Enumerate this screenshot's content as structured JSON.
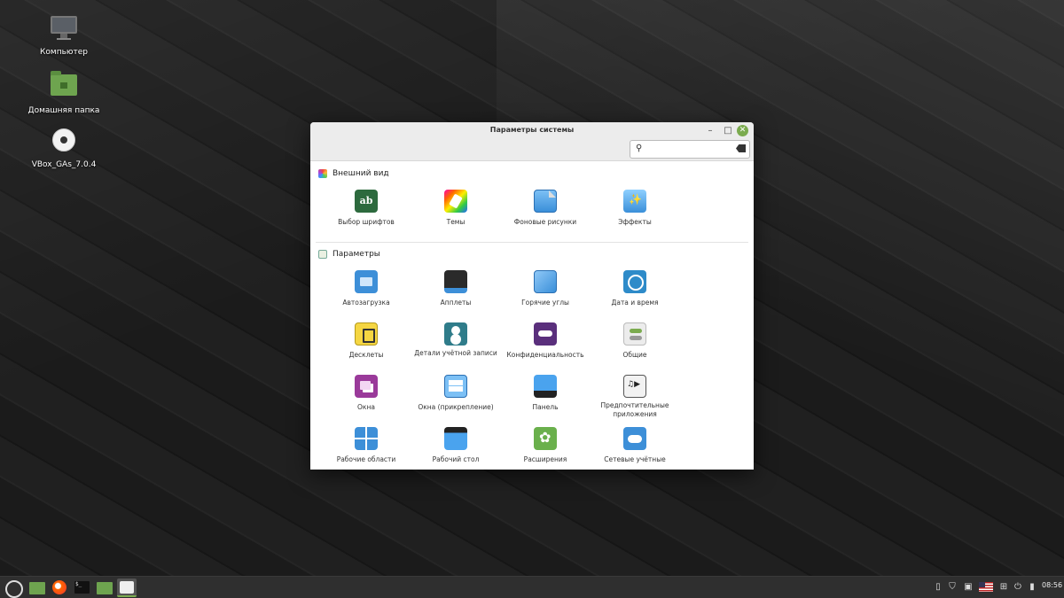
{
  "desktop": {
    "icons": [
      {
        "label": "Компьютер",
        "icon": "computer-icon"
      },
      {
        "label": "Домашняя папка",
        "icon": "home-folder-icon"
      },
      {
        "label": "VBox_GAs_7.0.4",
        "icon": "disc-icon"
      }
    ]
  },
  "window": {
    "title": "Параметры системы",
    "search": {
      "value": "",
      "placeholder": ""
    },
    "sections": [
      {
        "title": "Внешний вид",
        "items": [
          "Выбор шрифтов",
          "Темы",
          "Фоновые рисунки",
          "Эффекты"
        ]
      },
      {
        "title": "Параметры",
        "items": [
          "Автозагрузка",
          "Апплеты",
          "Горячие углы",
          "Дата и время",
          "Десклеты",
          "Детали учётной записи",
          "Конфиденциальность",
          "Общие",
          "Окна",
          "Окна (прикрепление)",
          "Панель",
          "Предпочтительные приложения",
          "Рабочие области",
          "Рабочий стол",
          "Расширения",
          "Сетевые учётные"
        ]
      }
    ]
  },
  "taskbar": {
    "apps": [
      "menu-icon",
      "files-icon",
      "firefox-icon",
      "terminal-icon",
      "files-icon",
      "system-settings-icon"
    ],
    "tray": [
      "clipboard-icon",
      "shield-icon",
      "update-icon",
      "us-flag-icon",
      "network-icon",
      "power-icon",
      "battery-icon"
    ],
    "clock": "08:56"
  },
  "colors": {
    "accent": "#7bab4f",
    "taskbar": "#2f2f2f"
  }
}
